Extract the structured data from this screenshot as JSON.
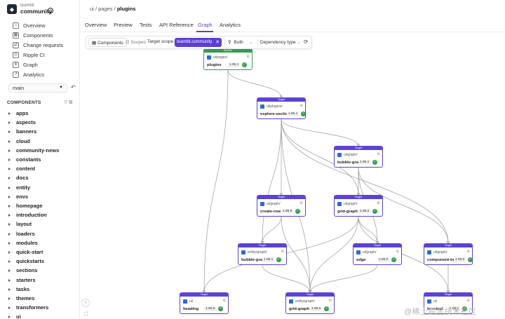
{
  "org": {
    "label": "teambit",
    "name": "community",
    "badge": "✓"
  },
  "sidebar": {
    "nav": [
      {
        "label": "Overview",
        "icon": "home-icon"
      },
      {
        "label": "Components",
        "icon": "components-icon"
      },
      {
        "label": "Change requests",
        "icon": "change-request-icon"
      },
      {
        "label": "Ripple CI",
        "icon": "ripple-icon"
      },
      {
        "label": "Graph",
        "icon": "graph-icon"
      },
      {
        "label": "Analytics",
        "icon": "analytics-icon"
      }
    ],
    "branch": "main",
    "components_header": "COMPONENTS",
    "tree": [
      "apps",
      "aspects",
      "banners",
      "cloud",
      "community-news",
      "constants",
      "content",
      "docs",
      "entity",
      "envs",
      "homepage",
      "introduction",
      "layout",
      "loaders",
      "modules",
      "quick-start",
      "quickstarts",
      "sections",
      "starters",
      "tasks",
      "themes",
      "transformers",
      "ui"
    ]
  },
  "breadcrumb": {
    "a": "ui",
    "sep": "/",
    "b": "pages",
    "c": "plugins"
  },
  "tabs": [
    "Overview",
    "Preview",
    "Tests",
    "API Reference",
    "Graph",
    "Analytics"
  ],
  "active_tab": "Graph",
  "toolbar": {
    "components": "Components",
    "scopes": "Scopes",
    "target_scope_label": "Target scope:",
    "target_scope_value": "teambit.community",
    "both": "Both",
    "dependency_type": "Dependency type"
  },
  "nodes": [
    {
      "id": "plugins",
      "kind": "Seeder",
      "ns": "ui/pages/",
      "name": "plugins",
      "version": "1.96.1"
    },
    {
      "id": "explore-section",
      "kind": "Target",
      "ns": "ui/plugins/",
      "name": "explore-section",
      "version": "1.96.1"
    },
    {
      "id": "bubble-graph-a",
      "kind": "Target",
      "ns": "ui/graph/",
      "name": "bubble-graph",
      "version": "1.96.1"
    },
    {
      "id": "create-row",
      "kind": "Target",
      "ns": "ui/graph/",
      "name": "create-row",
      "version": "1.96.9"
    },
    {
      "id": "grid-graph-a",
      "kind": "Target",
      "ns": "ui/graph/",
      "name": "grid-graph",
      "version": "1.95.0"
    },
    {
      "id": "bubble-graph-b",
      "kind": "Target",
      "ns": "entity/graph/",
      "name": "bubble-graph",
      "version": "1.96.1"
    },
    {
      "id": "edge",
      "kind": "Target",
      "ns": "ui/graph/",
      "name": "edge",
      "version": "1.95.0"
    },
    {
      "id": "component-bubble",
      "kind": "Target",
      "ns": "ui/graph/",
      "name": "component-bubble",
      "version": "1.95.0"
    },
    {
      "id": "heading",
      "kind": "Target",
      "ns": "ui/",
      "name": "heading",
      "version": "1.96.9"
    },
    {
      "id": "grid-graph-b",
      "kind": "Target",
      "ns": "entity/graph/",
      "name": "grid-graph",
      "version": "1.96.0"
    },
    {
      "id": "terminal",
      "kind": "Target",
      "ns": "ui/",
      "name": "terminal",
      "version": "1.95.1"
    }
  ],
  "watermark": "@稀土掘金技术社区"
}
